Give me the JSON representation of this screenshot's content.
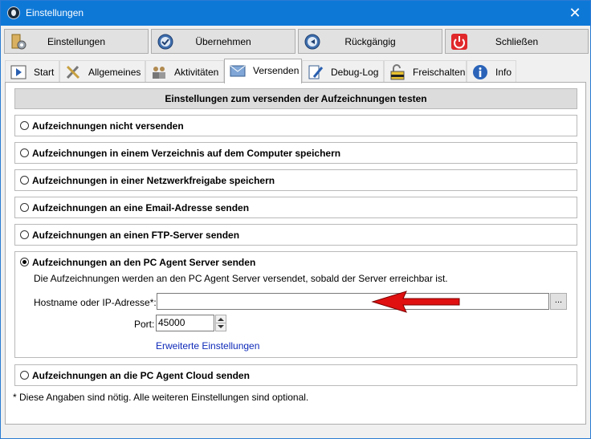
{
  "window": {
    "title": "Einstellungen",
    "close_glyph": "✕"
  },
  "toolbar": {
    "buttons": [
      {
        "label": "Einstellungen",
        "icon": "settings-icon"
      },
      {
        "label": "Übernehmen",
        "icon": "apply-icon"
      },
      {
        "label": "Rückgängig",
        "icon": "undo-icon"
      },
      {
        "label": "Schließen",
        "icon": "power-icon"
      }
    ]
  },
  "tabs": [
    {
      "label": "Start",
      "icon": "play-icon"
    },
    {
      "label": "Allgemeines",
      "icon": "tools-icon"
    },
    {
      "label": "Aktivitäten",
      "icon": "people-icon"
    },
    {
      "label": "Versenden",
      "icon": "mail-icon",
      "active": true
    },
    {
      "label": "Debug-Log",
      "icon": "edit-icon"
    },
    {
      "label": "Freischalten",
      "icon": "unlock-icon"
    },
    {
      "label": "Info",
      "icon": "info-icon"
    }
  ],
  "panel": {
    "header": "Einstellungen zum versenden der Aufzeichnungen testen",
    "options": [
      {
        "label": "Aufzeichnungen nicht versenden",
        "checked": false
      },
      {
        "label": "Aufzeichnungen in einem Verzeichnis auf dem Computer speichern",
        "checked": false
      },
      {
        "label": "Aufzeichnungen in einer Netzwerkfreigabe speichern",
        "checked": false
      },
      {
        "label": "Aufzeichnungen an eine Email-Adresse senden",
        "checked": false
      },
      {
        "label": "Aufzeichnungen an einen FTP-Server senden",
        "checked": false
      },
      {
        "label": "Aufzeichnungen an den PC Agent Server senden",
        "checked": true
      },
      {
        "label": "Aufzeichnungen an die PC Agent Cloud senden",
        "checked": false
      }
    ],
    "server": {
      "description": "Die Aufzeichnungen werden an den PC Agent Server versendet, sobald der Server erreichbar ist.",
      "host_label": "Hostname oder IP-Adresse*:",
      "host_value": "",
      "browse_label": "...",
      "port_label": "Port:",
      "port_value": "45000",
      "advanced_link": "Erweiterte Einstellungen"
    },
    "footnote": "* Diese Angaben sind nötig. Alle weiteren Einstellungen sind optional."
  },
  "colors": {
    "titlebar": "#0e78d7",
    "link": "#0d29b8",
    "annotation_arrow": "#e01010"
  }
}
